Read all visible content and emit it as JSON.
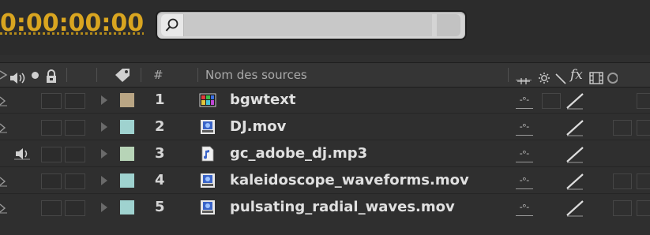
{
  "timecode": "0:00:00:00",
  "search": {
    "placeholder": ""
  },
  "header": {
    "hash_label": "#",
    "source_name_label": "Nom des sources",
    "fx_label": "fx"
  },
  "layers": [
    {
      "index": "1",
      "name": "bgwtext",
      "label_color": "#b9a584",
      "icon": "composition-icon",
      "has_video": true,
      "has_audio": false
    },
    {
      "index": "2",
      "name": "DJ.mov",
      "label_color": "#9fd2cf",
      "icon": "footage-icon",
      "has_video": true,
      "has_audio": false
    },
    {
      "index": "3",
      "name": "gc_adobe_dj.mp3",
      "label_color": "#b7d4b7",
      "icon": "audio-file-icon",
      "has_video": false,
      "has_audio": true
    },
    {
      "index": "4",
      "name": "kaleidoscope_waveforms.mov",
      "label_color": "#9fd2cf",
      "icon": "footage-icon",
      "has_video": true,
      "has_audio": false
    },
    {
      "index": "5",
      "name": "pulsating_radial_waves.mov",
      "label_color": "#9fd2cf",
      "icon": "footage-icon",
      "has_video": true,
      "has_audio": false
    }
  ],
  "colors": {
    "timecode": "#d9a520",
    "background": "#2f2f2f",
    "text": "#e0e0e0"
  }
}
